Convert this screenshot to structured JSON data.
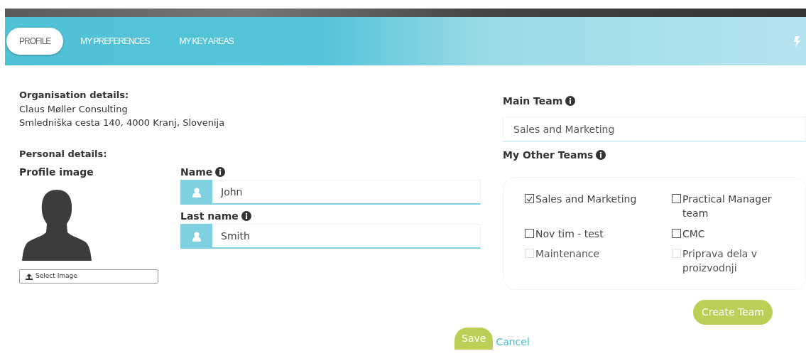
{
  "tabs": [
    {
      "label": "PROFILE",
      "selected": true
    },
    {
      "label": "MY PREFERENCES",
      "selected": false
    },
    {
      "label": "MY KEY AREAS",
      "selected": false
    }
  ],
  "organisation": {
    "heading": "Organisation details:",
    "name": "Claus Møller Consulting",
    "address": "Smledniška cesta 140, 4000 Kranj, Slovenija"
  },
  "personal": {
    "heading": "Personal details:",
    "profile_image_label": "Profile image",
    "select_image_button": "Select Image",
    "fields": [
      {
        "label": "Name",
        "value": "John"
      },
      {
        "label": "Last name",
        "value": "Smith"
      }
    ]
  },
  "main_team": {
    "label": "Main Team",
    "value": "Sales and Marketing"
  },
  "other_teams": {
    "label": "My Other Teams",
    "items": [
      {
        "label": "Sales and Marketing",
        "checked": true,
        "disabled": false
      },
      {
        "label": "Practical Manager team",
        "checked": false,
        "disabled": false
      },
      {
        "label": "Nov tim - test",
        "checked": false,
        "disabled": false
      },
      {
        "label": "CMC",
        "checked": false,
        "disabled": false
      },
      {
        "label": "Maintenance",
        "checked": false,
        "disabled": true
      },
      {
        "label": "Priprava dela v proizvodnji",
        "checked": false,
        "disabled": true
      }
    ]
  },
  "create_team_button": "Create Team",
  "save_button": "Save",
  "cancel_link": "Cancel"
}
